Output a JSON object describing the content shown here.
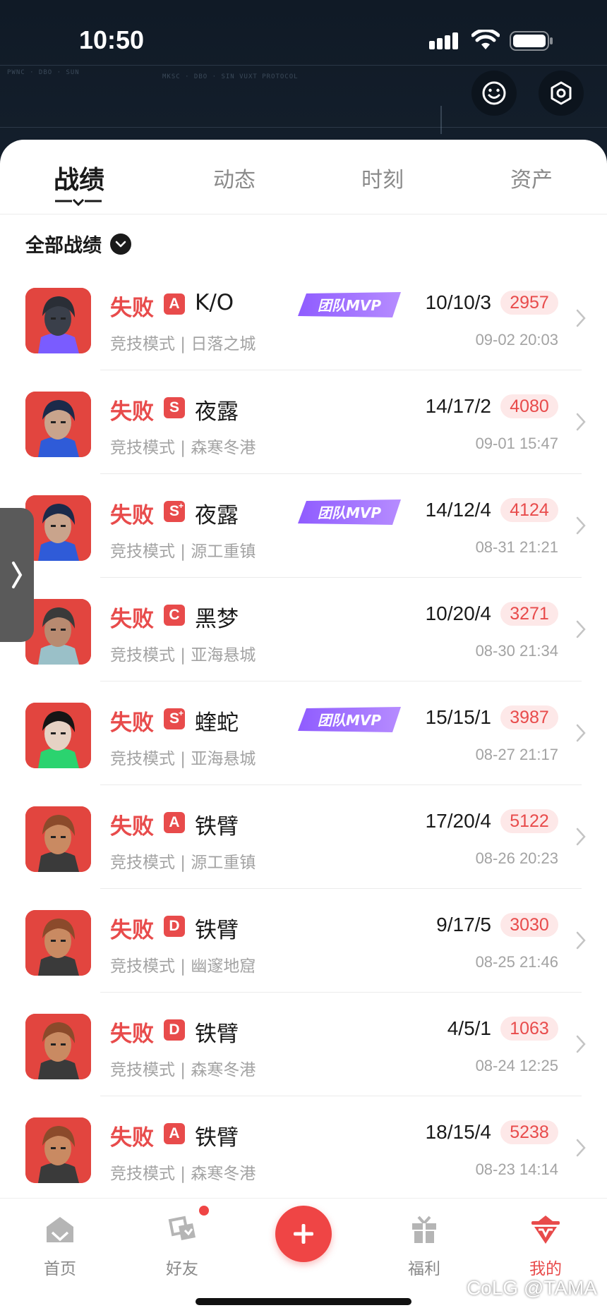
{
  "status_bar": {
    "time": "10:50"
  },
  "tabs": [
    {
      "label": "战绩",
      "active": true
    },
    {
      "label": "动态",
      "active": false
    },
    {
      "label": "时刻",
      "active": false
    },
    {
      "label": "资产",
      "active": false
    }
  ],
  "filter": {
    "label": "全部战绩"
  },
  "mvp_label": "团队MVP",
  "matches": [
    {
      "result": "失败",
      "rank": "A",
      "agent": "K/O",
      "mode": "竞技模式 | 日落之城",
      "mvp": true,
      "kda": "10/10/3",
      "score": "2957",
      "date": "09-02 20:03",
      "avatar": "ko"
    },
    {
      "result": "失败",
      "rank": "S",
      "agent": "夜露",
      "mode": "竞技模式 | 森寒冬港",
      "mvp": false,
      "kda": "14/17/2",
      "score": "4080",
      "date": "09-01 15:47",
      "avatar": "yoru"
    },
    {
      "result": "失败",
      "rank": "S+",
      "agent": "夜露",
      "mode": "竞技模式 | 源工重镇",
      "mvp": true,
      "kda": "14/12/4",
      "score": "4124",
      "date": "08-31 21:21",
      "avatar": "yoru"
    },
    {
      "result": "失败",
      "rank": "C",
      "agent": "黑梦",
      "mode": "竞技模式 | 亚海悬城",
      "mvp": false,
      "kda": "10/20/4",
      "score": "3271",
      "date": "08-30 21:34",
      "avatar": "fade"
    },
    {
      "result": "失败",
      "rank": "S+",
      "agent": "蝰蛇",
      "mode": "竞技模式 | 亚海悬城",
      "mvp": true,
      "kda": "15/15/1",
      "score": "3987",
      "date": "08-27 21:17",
      "avatar": "viper"
    },
    {
      "result": "失败",
      "rank": "A",
      "agent": "铁臂",
      "mode": "竞技模式 | 源工重镇",
      "mvp": false,
      "kda": "17/20/4",
      "score": "5122",
      "date": "08-26 20:23",
      "avatar": "breach"
    },
    {
      "result": "失败",
      "rank": "D",
      "agent": "铁臂",
      "mode": "竞技模式 | 幽邃地窟",
      "mvp": false,
      "kda": "9/17/5",
      "score": "3030",
      "date": "08-25 21:46",
      "avatar": "breach"
    },
    {
      "result": "失败",
      "rank": "D",
      "agent": "铁臂",
      "mode": "竞技模式 | 森寒冬港",
      "mvp": false,
      "kda": "4/5/1",
      "score": "1063",
      "date": "08-24 12:25",
      "avatar": "breach"
    },
    {
      "result": "失败",
      "rank": "A",
      "agent": "铁臂",
      "mode": "竞技模式 | 森寒冬港",
      "mvp": false,
      "kda": "18/15/4",
      "score": "5238",
      "date": "08-23 14:14",
      "avatar": "breach"
    }
  ],
  "bottom_nav": [
    {
      "label": "首页",
      "icon": "home-icon",
      "active": false
    },
    {
      "label": "好友",
      "icon": "friends-icon",
      "active": false,
      "badge": true
    },
    {
      "label": "",
      "icon": "plus-icon",
      "fab": true
    },
    {
      "label": "福利",
      "icon": "gift-icon",
      "active": false
    },
    {
      "label": "我的",
      "icon": "profile-icon",
      "active": true
    }
  ],
  "watermark": "CoLG @TAMA",
  "colors": {
    "accent": "#e84b4b",
    "header_bg": "#121c28",
    "score_bg": "#fde8e8"
  }
}
